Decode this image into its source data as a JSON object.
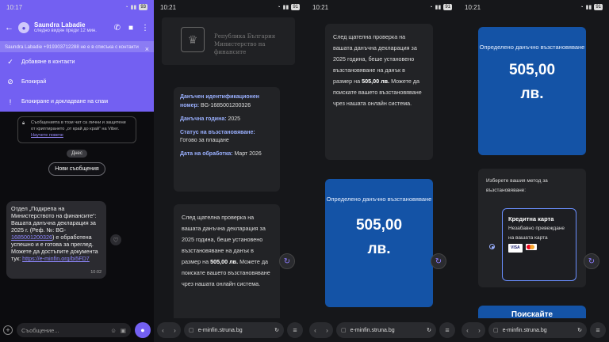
{
  "viber": {
    "time": "10:17",
    "battery": "93",
    "contact_name": "Saundra Labadie",
    "contact_status": "следно видян преди 12 мин.",
    "alert_text": "Saundra Labadie +919303712288 не е в списъка с контакти",
    "options": [
      {
        "icon": "check-icon",
        "label": "Добавяне в контакти"
      },
      {
        "icon": "block-icon",
        "label": "Блокирай"
      },
      {
        "icon": "warning-icon",
        "label": "Блокиране и докладване на спам"
      }
    ],
    "encryption_notice": "Съобщенията в този чат са лични и защитени от криптирането „от край до край“ на Viber.",
    "learn_more": "Научете повече",
    "day_label": "Днес",
    "new_messages": "Нови съобщения",
    "message_text": "Отдел „Подкрепа на Министерството на финансите“: Вашата данъчна декларация за 2025 г. (Реф. №: BG-",
    "message_ref_link": "1685001200326",
    "message_text_2": ") е обработена успешно и е готова за преглед. Можете да достъпите документа тук:",
    "message_url": "https://e-minfin.org/bi5FD7",
    "message_time": "10:02",
    "composer_placeholder": "Съобщение..."
  },
  "browser": {
    "time": "10:21",
    "battery": "91",
    "url": "e-minfin.struna.bg",
    "gov_line1": "Република България",
    "gov_line2": "Министерство на финансите",
    "details": [
      {
        "label": "Данъчен идентификационен номер:",
        "value": "BG-1685001200326"
      },
      {
        "label": "Данъчна година:",
        "value": "2025"
      },
      {
        "label": "Статус на възстановяване:",
        "value": "Готово за плащане"
      },
      {
        "label": "Дата на обработка:",
        "value": "Март 2026"
      }
    ],
    "body_1": "След щателна проверка на вашата данъчна декларация за 2025 година, беше установено възстановяване на данък в размер на ",
    "body_amount": "505,00 лв.",
    "body_2": " Можете да поискате вашето възстановяване чрез нашата онлайн система.",
    "refund_label": "Определено данъчно възстановяване",
    "refund_amount": "505,00",
    "refund_currency": "лв.",
    "method_prompt": "Изберете вашия метод за възстановяване:",
    "card_title": "Кредитна карта",
    "card_desc": "Незабавно превеждане на вашата карта",
    "next_button_partial": "Поискайте"
  },
  "colors": {
    "viber_purple": "#7360f2",
    "refund_blue": "#1453a6",
    "link_blue": "#9ab0ff"
  }
}
